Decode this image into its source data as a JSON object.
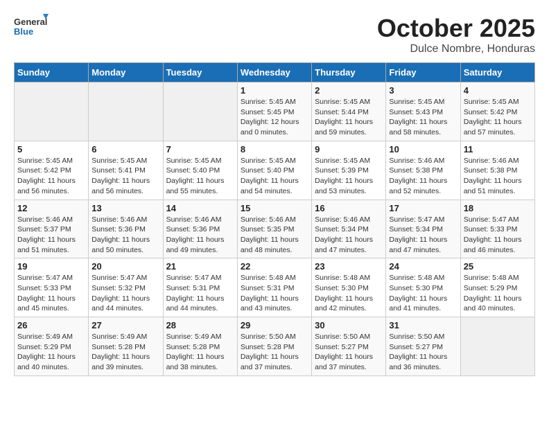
{
  "logo": {
    "text_general": "General",
    "text_blue": "Blue"
  },
  "header": {
    "month_title": "October 2025",
    "location": "Dulce Nombre, Honduras"
  },
  "weekdays": [
    "Sunday",
    "Monday",
    "Tuesday",
    "Wednesday",
    "Thursday",
    "Friday",
    "Saturday"
  ],
  "weeks": [
    [
      {
        "day": "",
        "sunrise": "",
        "sunset": "",
        "daylight": ""
      },
      {
        "day": "",
        "sunrise": "",
        "sunset": "",
        "daylight": ""
      },
      {
        "day": "",
        "sunrise": "",
        "sunset": "",
        "daylight": ""
      },
      {
        "day": "1",
        "sunrise": "Sunrise: 5:45 AM",
        "sunset": "Sunset: 5:45 PM",
        "daylight": "Daylight: 12 hours and 0 minutes."
      },
      {
        "day": "2",
        "sunrise": "Sunrise: 5:45 AM",
        "sunset": "Sunset: 5:44 PM",
        "daylight": "Daylight: 11 hours and 59 minutes."
      },
      {
        "day": "3",
        "sunrise": "Sunrise: 5:45 AM",
        "sunset": "Sunset: 5:43 PM",
        "daylight": "Daylight: 11 hours and 58 minutes."
      },
      {
        "day": "4",
        "sunrise": "Sunrise: 5:45 AM",
        "sunset": "Sunset: 5:42 PM",
        "daylight": "Daylight: 11 hours and 57 minutes."
      }
    ],
    [
      {
        "day": "5",
        "sunrise": "Sunrise: 5:45 AM",
        "sunset": "Sunset: 5:42 PM",
        "daylight": "Daylight: 11 hours and 56 minutes."
      },
      {
        "day": "6",
        "sunrise": "Sunrise: 5:45 AM",
        "sunset": "Sunset: 5:41 PM",
        "daylight": "Daylight: 11 hours and 56 minutes."
      },
      {
        "day": "7",
        "sunrise": "Sunrise: 5:45 AM",
        "sunset": "Sunset: 5:40 PM",
        "daylight": "Daylight: 11 hours and 55 minutes."
      },
      {
        "day": "8",
        "sunrise": "Sunrise: 5:45 AM",
        "sunset": "Sunset: 5:40 PM",
        "daylight": "Daylight: 11 hours and 54 minutes."
      },
      {
        "day": "9",
        "sunrise": "Sunrise: 5:45 AM",
        "sunset": "Sunset: 5:39 PM",
        "daylight": "Daylight: 11 hours and 53 minutes."
      },
      {
        "day": "10",
        "sunrise": "Sunrise: 5:46 AM",
        "sunset": "Sunset: 5:38 PM",
        "daylight": "Daylight: 11 hours and 52 minutes."
      },
      {
        "day": "11",
        "sunrise": "Sunrise: 5:46 AM",
        "sunset": "Sunset: 5:38 PM",
        "daylight": "Daylight: 11 hours and 51 minutes."
      }
    ],
    [
      {
        "day": "12",
        "sunrise": "Sunrise: 5:46 AM",
        "sunset": "Sunset: 5:37 PM",
        "daylight": "Daylight: 11 hours and 51 minutes."
      },
      {
        "day": "13",
        "sunrise": "Sunrise: 5:46 AM",
        "sunset": "Sunset: 5:36 PM",
        "daylight": "Daylight: 11 hours and 50 minutes."
      },
      {
        "day": "14",
        "sunrise": "Sunrise: 5:46 AM",
        "sunset": "Sunset: 5:36 PM",
        "daylight": "Daylight: 11 hours and 49 minutes."
      },
      {
        "day": "15",
        "sunrise": "Sunrise: 5:46 AM",
        "sunset": "Sunset: 5:35 PM",
        "daylight": "Daylight: 11 hours and 48 minutes."
      },
      {
        "day": "16",
        "sunrise": "Sunrise: 5:46 AM",
        "sunset": "Sunset: 5:34 PM",
        "daylight": "Daylight: 11 hours and 47 minutes."
      },
      {
        "day": "17",
        "sunrise": "Sunrise: 5:47 AM",
        "sunset": "Sunset: 5:34 PM",
        "daylight": "Daylight: 11 hours and 47 minutes."
      },
      {
        "day": "18",
        "sunrise": "Sunrise: 5:47 AM",
        "sunset": "Sunset: 5:33 PM",
        "daylight": "Daylight: 11 hours and 46 minutes."
      }
    ],
    [
      {
        "day": "19",
        "sunrise": "Sunrise: 5:47 AM",
        "sunset": "Sunset: 5:33 PM",
        "daylight": "Daylight: 11 hours and 45 minutes."
      },
      {
        "day": "20",
        "sunrise": "Sunrise: 5:47 AM",
        "sunset": "Sunset: 5:32 PM",
        "daylight": "Daylight: 11 hours and 44 minutes."
      },
      {
        "day": "21",
        "sunrise": "Sunrise: 5:47 AM",
        "sunset": "Sunset: 5:31 PM",
        "daylight": "Daylight: 11 hours and 44 minutes."
      },
      {
        "day": "22",
        "sunrise": "Sunrise: 5:48 AM",
        "sunset": "Sunset: 5:31 PM",
        "daylight": "Daylight: 11 hours and 43 minutes."
      },
      {
        "day": "23",
        "sunrise": "Sunrise: 5:48 AM",
        "sunset": "Sunset: 5:30 PM",
        "daylight": "Daylight: 11 hours and 42 minutes."
      },
      {
        "day": "24",
        "sunrise": "Sunrise: 5:48 AM",
        "sunset": "Sunset: 5:30 PM",
        "daylight": "Daylight: 11 hours and 41 minutes."
      },
      {
        "day": "25",
        "sunrise": "Sunrise: 5:48 AM",
        "sunset": "Sunset: 5:29 PM",
        "daylight": "Daylight: 11 hours and 40 minutes."
      }
    ],
    [
      {
        "day": "26",
        "sunrise": "Sunrise: 5:49 AM",
        "sunset": "Sunset: 5:29 PM",
        "daylight": "Daylight: 11 hours and 40 minutes."
      },
      {
        "day": "27",
        "sunrise": "Sunrise: 5:49 AM",
        "sunset": "Sunset: 5:28 PM",
        "daylight": "Daylight: 11 hours and 39 minutes."
      },
      {
        "day": "28",
        "sunrise": "Sunrise: 5:49 AM",
        "sunset": "Sunset: 5:28 PM",
        "daylight": "Daylight: 11 hours and 38 minutes."
      },
      {
        "day": "29",
        "sunrise": "Sunrise: 5:50 AM",
        "sunset": "Sunset: 5:28 PM",
        "daylight": "Daylight: 11 hours and 37 minutes."
      },
      {
        "day": "30",
        "sunrise": "Sunrise: 5:50 AM",
        "sunset": "Sunset: 5:27 PM",
        "daylight": "Daylight: 11 hours and 37 minutes."
      },
      {
        "day": "31",
        "sunrise": "Sunrise: 5:50 AM",
        "sunset": "Sunset: 5:27 PM",
        "daylight": "Daylight: 11 hours and 36 minutes."
      },
      {
        "day": "",
        "sunrise": "",
        "sunset": "",
        "daylight": ""
      }
    ]
  ]
}
